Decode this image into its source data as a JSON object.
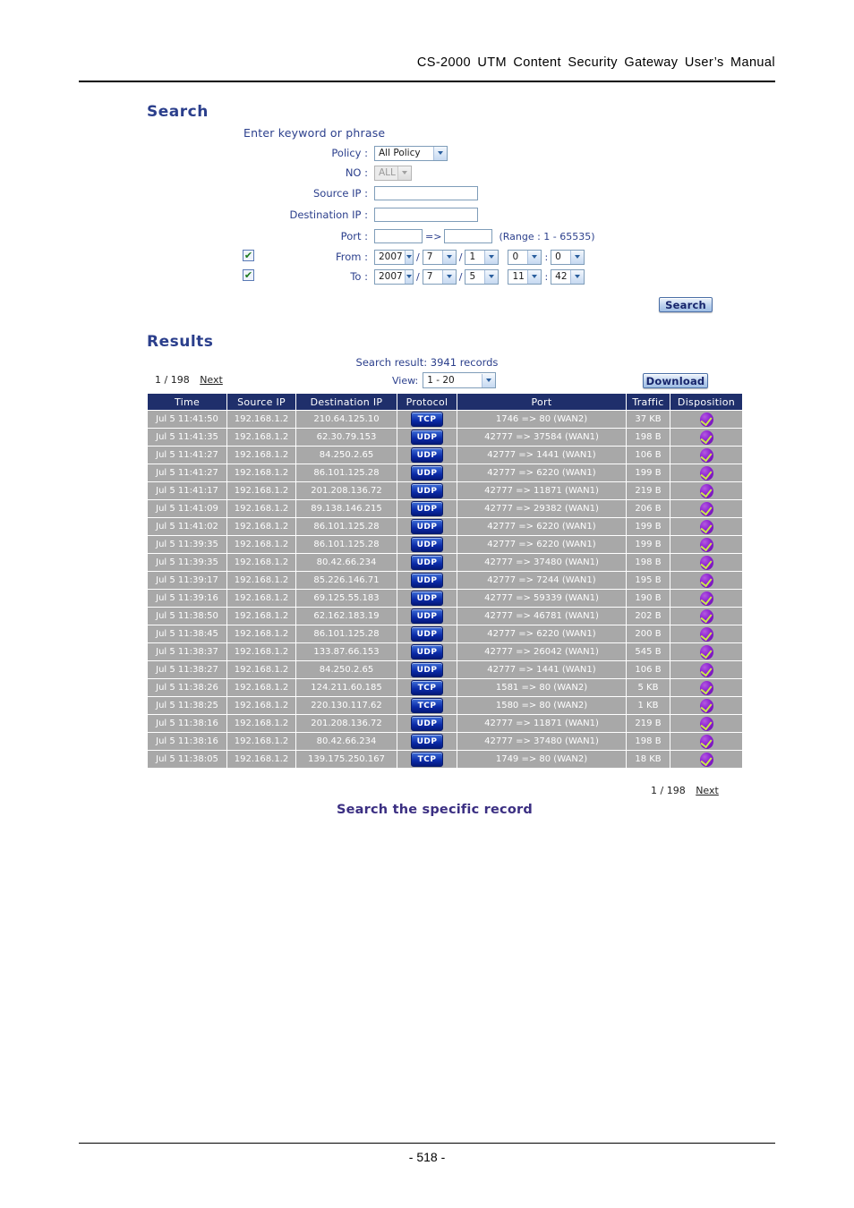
{
  "document": {
    "header_title": "CS-2000  UTM  Content  Security  Gateway  User’s  Manual",
    "page_number": "- 518 -",
    "caption": "Search the specific record"
  },
  "search_panel": {
    "title": "Search",
    "keyword_prompt": "Enter keyword or phrase",
    "fields": {
      "policy_label": "Policy :",
      "policy_value": "All Policy",
      "no_label": "NO :",
      "no_value": "ALL",
      "source_ip_label": "Source IP :",
      "source_ip_value": "",
      "destination_ip_label": "Destination IP :",
      "destination_ip_value": "",
      "port_label": "Port :",
      "port_from_value": "",
      "port_to_value": "",
      "port_separator": "=>",
      "port_range_note": "(Range : 1 - 65535)",
      "from_label": "From :",
      "from_checked": "✔",
      "from_year": "2007",
      "from_month": "7",
      "from_day": "1",
      "from_hour": "0",
      "from_minute": "0",
      "to_label": "To :",
      "to_checked": "✔",
      "to_year": "2007",
      "to_month": "7",
      "to_day": "5",
      "to_hour": "11",
      "to_minute": "42",
      "date_sep": "/",
      "time_sep": ":"
    },
    "search_button": "Search"
  },
  "results_panel": {
    "title": "Results",
    "result_count_text": "Search result: 3941 records",
    "pager_top": "1 / 198",
    "pager_top_next": "Next",
    "pager_bottom": "1 / 198",
    "pager_bottom_next": "Next",
    "view_label": "View:",
    "view_value": "1 - 20",
    "download_button": "Download",
    "columns": [
      "Time",
      "Source IP",
      "Destination IP",
      "Protocol",
      "Port",
      "Traffic",
      "Disposition"
    ],
    "rows": [
      {
        "time": "Jul 5 11:41:50",
        "src": "192.168.1.2",
        "dst": "210.64.125.10",
        "proto": "TCP",
        "port": "1746 => 80 (WAN2)",
        "traffic": "37 KB",
        "disp": "allow-check-icon"
      },
      {
        "time": "Jul 5 11:41:35",
        "src": "192.168.1.2",
        "dst": "62.30.79.153",
        "proto": "UDP",
        "port": "42777 => 37584 (WAN1)",
        "traffic": "198 B",
        "disp": "allow-check-icon"
      },
      {
        "time": "Jul 5 11:41:27",
        "src": "192.168.1.2",
        "dst": "84.250.2.65",
        "proto": "UDP",
        "port": "42777 => 1441 (WAN1)",
        "traffic": "106 B",
        "disp": "allow-check-icon"
      },
      {
        "time": "Jul 5 11:41:27",
        "src": "192.168.1.2",
        "dst": "86.101.125.28",
        "proto": "UDP",
        "port": "42777 => 6220 (WAN1)",
        "traffic": "199 B",
        "disp": "allow-check-icon"
      },
      {
        "time": "Jul 5 11:41:17",
        "src": "192.168.1.2",
        "dst": "201.208.136.72",
        "proto": "UDP",
        "port": "42777 => 11871 (WAN1)",
        "traffic": "219 B",
        "disp": "allow-check-icon"
      },
      {
        "time": "Jul 5 11:41:09",
        "src": "192.168.1.2",
        "dst": "89.138.146.215",
        "proto": "UDP",
        "port": "42777 => 29382 (WAN1)",
        "traffic": "206 B",
        "disp": "allow-check-icon"
      },
      {
        "time": "Jul 5 11:41:02",
        "src": "192.168.1.2",
        "dst": "86.101.125.28",
        "proto": "UDP",
        "port": "42777 => 6220 (WAN1)",
        "traffic": "199 B",
        "disp": "allow-check-icon"
      },
      {
        "time": "Jul 5 11:39:35",
        "src": "192.168.1.2",
        "dst": "86.101.125.28",
        "proto": "UDP",
        "port": "42777 => 6220 (WAN1)",
        "traffic": "199 B",
        "disp": "allow-check-icon"
      },
      {
        "time": "Jul 5 11:39:35",
        "src": "192.168.1.2",
        "dst": "80.42.66.234",
        "proto": "UDP",
        "port": "42777 => 37480 (WAN1)",
        "traffic": "198 B",
        "disp": "allow-check-icon"
      },
      {
        "time": "Jul 5 11:39:17",
        "src": "192.168.1.2",
        "dst": "85.226.146.71",
        "proto": "UDP",
        "port": "42777 => 7244 (WAN1)",
        "traffic": "195 B",
        "disp": "allow-check-icon"
      },
      {
        "time": "Jul 5 11:39:16",
        "src": "192.168.1.2",
        "dst": "69.125.55.183",
        "proto": "UDP",
        "port": "42777 => 59339 (WAN1)",
        "traffic": "190 B",
        "disp": "allow-check-icon"
      },
      {
        "time": "Jul 5 11:38:50",
        "src": "192.168.1.2",
        "dst": "62.162.183.19",
        "proto": "UDP",
        "port": "42777 => 46781 (WAN1)",
        "traffic": "202 B",
        "disp": "allow-check-icon"
      },
      {
        "time": "Jul 5 11:38:45",
        "src": "192.168.1.2",
        "dst": "86.101.125.28",
        "proto": "UDP",
        "port": "42777 => 6220 (WAN1)",
        "traffic": "200 B",
        "disp": "allow-check-icon"
      },
      {
        "time": "Jul 5 11:38:37",
        "src": "192.168.1.2",
        "dst": "133.87.66.153",
        "proto": "UDP",
        "port": "42777 => 26042 (WAN1)",
        "traffic": "545 B",
        "disp": "allow-check-icon"
      },
      {
        "time": "Jul 5 11:38:27",
        "src": "192.168.1.2",
        "dst": "84.250.2.65",
        "proto": "UDP",
        "port": "42777 => 1441 (WAN1)",
        "traffic": "106 B",
        "disp": "allow-check-icon"
      },
      {
        "time": "Jul 5 11:38:26",
        "src": "192.168.1.2",
        "dst": "124.211.60.185",
        "proto": "TCP",
        "port": "1581 => 80 (WAN2)",
        "traffic": "5 KB",
        "disp": "allow-check-icon"
      },
      {
        "time": "Jul 5 11:38:25",
        "src": "192.168.1.2",
        "dst": "220.130.117.62",
        "proto": "TCP",
        "port": "1580 => 80 (WAN2)",
        "traffic": "1 KB",
        "disp": "allow-check-icon"
      },
      {
        "time": "Jul 5 11:38:16",
        "src": "192.168.1.2",
        "dst": "201.208.136.72",
        "proto": "UDP",
        "port": "42777 => 11871 (WAN1)",
        "traffic": "219 B",
        "disp": "allow-check-icon"
      },
      {
        "time": "Jul 5 11:38:16",
        "src": "192.168.1.2",
        "dst": "80.42.66.234",
        "proto": "UDP",
        "port": "42777 => 37480 (WAN1)",
        "traffic": "198 B",
        "disp": "allow-check-icon"
      },
      {
        "time": "Jul 5 11:38:05",
        "src": "192.168.1.2",
        "dst": "139.175.250.167",
        "proto": "TCP",
        "port": "1749 => 80 (WAN2)",
        "traffic": "18 KB",
        "disp": "allow-check-icon"
      }
    ]
  },
  "colors": {
    "heading": "#2b3f8c",
    "table_header_bg": "#1f2f6b",
    "table_row_bg": "#a8a8a8",
    "caption": "#3b2f82",
    "proto_chip": "#0a2aa8",
    "disposition_icon": "#8a1fd0"
  }
}
